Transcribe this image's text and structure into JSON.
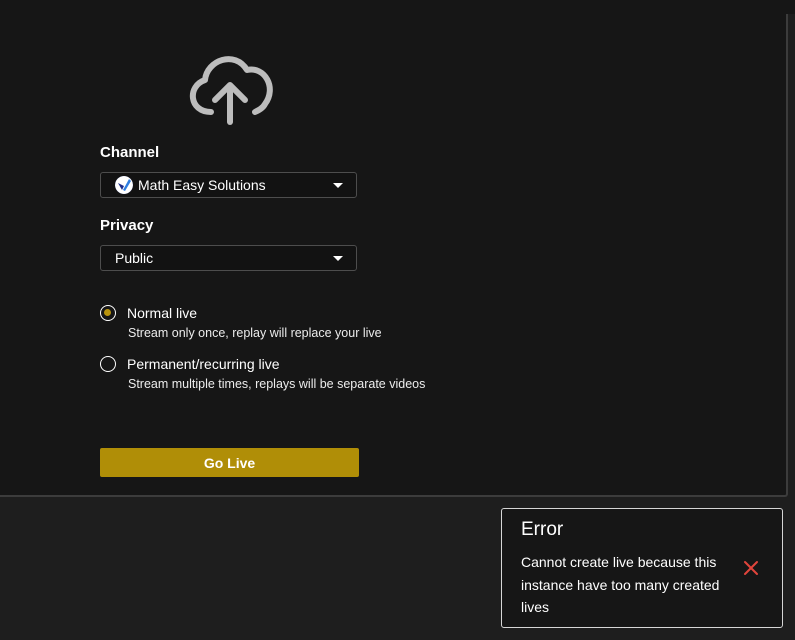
{
  "form": {
    "channel_label": "Channel",
    "channel_value": "Math Easy Solutions",
    "privacy_label": "Privacy",
    "privacy_value": "Public",
    "options": [
      {
        "title": "Normal live",
        "description": "Stream only once, replay will replace your live",
        "checked": true
      },
      {
        "title": "Permanent/recurring live",
        "description": "Stream multiple times, replays will be separate videos",
        "checked": false
      }
    ],
    "submit_label": "Go Live"
  },
  "toast": {
    "title": "Error",
    "message": "Cannot create live because this instance have too many created lives"
  },
  "icons": {
    "upload": "cloud-upload-icon",
    "channel_avatar": "channel-avatar-icon",
    "dropdown": "chevron-down-icon",
    "close": "close-icon"
  },
  "colors": {
    "accent": "#b08e07",
    "error_close": "#e0443b",
    "background": "#161616"
  }
}
